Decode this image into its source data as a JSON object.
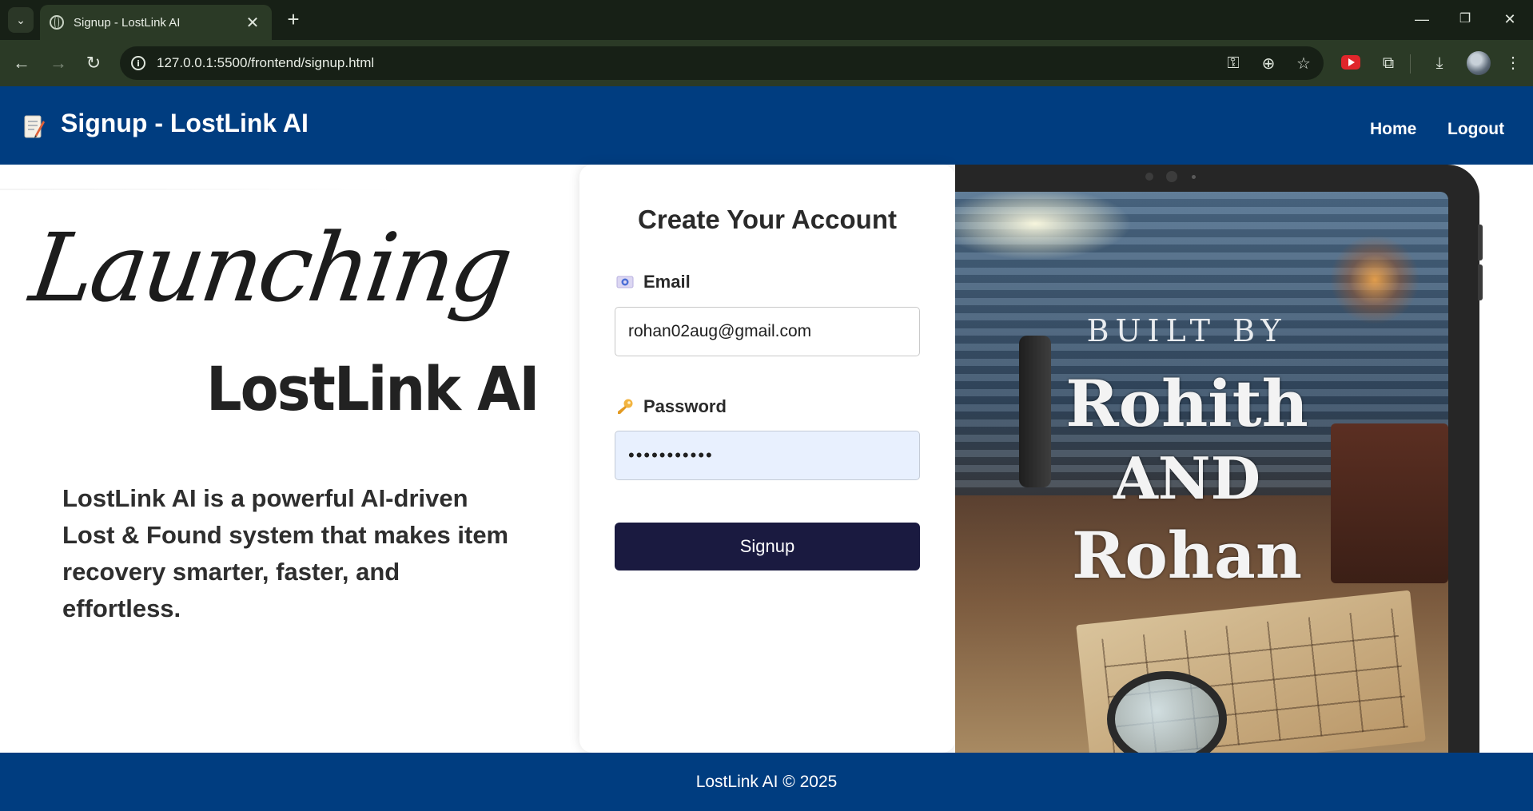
{
  "browser": {
    "tab_title": "Signup - LostLink AI",
    "tab_close": "✕",
    "new_tab": "+",
    "url": "127.0.0.1:5500/frontend/signup.html",
    "window_minimize": "—",
    "window_restore": "❐",
    "window_close": "✕"
  },
  "header": {
    "title": "Signup - LostLink AI",
    "nav": [
      {
        "label": "Home"
      },
      {
        "label": "Logout"
      }
    ]
  },
  "hero": {
    "script_line": "Launching",
    "brand_line": "LostLink AI",
    "description": "LostLink AI is a powerful AI-driven Lost & Found system that makes item recovery smarter, faster, and effortless."
  },
  "form": {
    "title": "Create Your Account",
    "email_label": "Email",
    "email_value": "rohan02aug@gmail.com",
    "password_label": "Password",
    "password_value": "•••••••••••",
    "submit_label": "Signup"
  },
  "poster": {
    "built_by": "BUILT BY",
    "name1": "Rohith",
    "and": "AND",
    "name2": "Rohan"
  },
  "footer": {
    "text": "LostLink AI © 2025"
  },
  "colors": {
    "header_bg": "#003d80",
    "footer_bg": "#003d80",
    "button_bg": "#1a1a40",
    "autofill_bg": "#e8f0fe",
    "chrome_bg": "#2b3a26"
  },
  "icons": {
    "logo": "memo-icon",
    "email": "email-icon",
    "password": "key-icon"
  }
}
